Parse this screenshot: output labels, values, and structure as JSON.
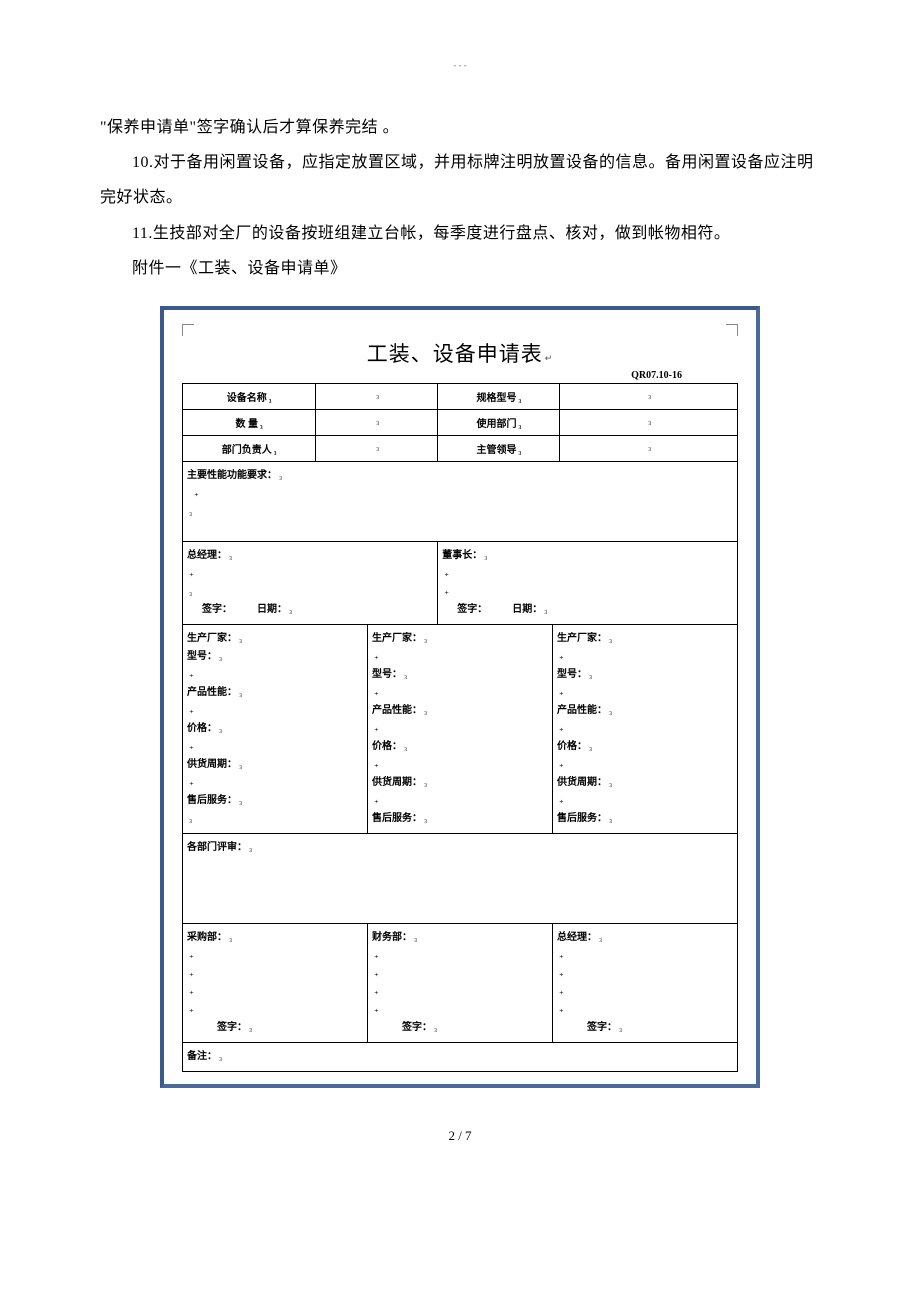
{
  "header_link": "- - -",
  "para1_prefix": "\"保养申请单\"",
  "para1_rest": "签字确认后才算保养完结 。",
  "para2": "10.对于备用闲置设备，应指定放置区域，并用标牌注明放置设备的信息。备用闲置设备应注明完好状态。",
  "para3": "11.生技部对全厂的设备按班组建立台帐，每季度进行盘点、核对，做到帐物相符。",
  "para4": "附件一《工装、设备申请单》",
  "form": {
    "title": "工装、设备申请表",
    "title_mark": "↵",
    "code": "QR07.10-16",
    "row1": {
      "c1": "设备名称",
      "c3": "规格型号"
    },
    "row2": {
      "c1": "数    量",
      "c3": "使用部门"
    },
    "row3": {
      "c1": "部门负责人",
      "c3": "主管领导"
    },
    "row4_label": "主要性能功能要求：",
    "approve_left_label": "总经理：",
    "approve_right_label": "董事长：",
    "sign_label": "签字：",
    "date_label": "日期：",
    "vendor": {
      "mfr": "生产厂家：",
      "model": "型号：",
      "perf": "产品性能：",
      "price": "价格：",
      "lead": "供货周期：",
      "svc": "售后服务："
    },
    "review_label": "各部门评审：",
    "purchase_label": "采购部：",
    "finance_label": "财务部：",
    "gm_label": "总经理：",
    "remark_label": "备注："
  },
  "mark": "₃",
  "dot_mark": "₊",
  "footer": "2 / 7"
}
